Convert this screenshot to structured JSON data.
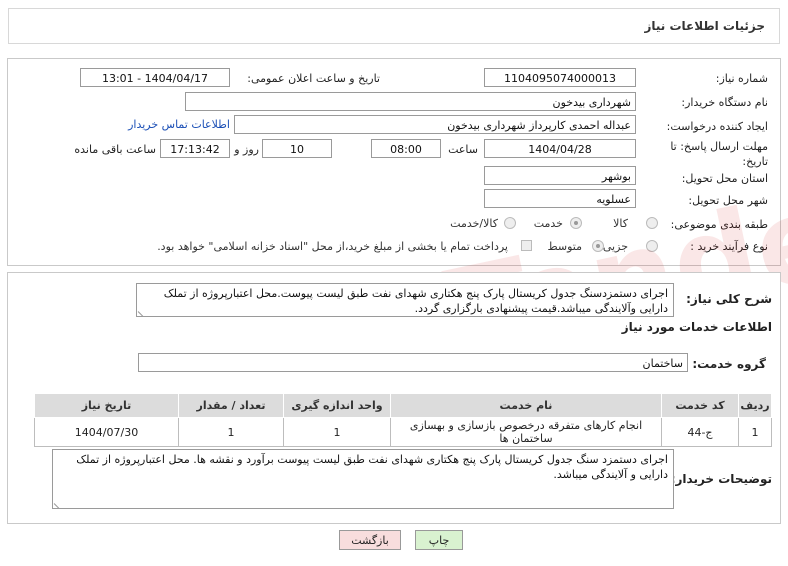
{
  "header": {
    "title": "جزئیات اطلاعات نیاز"
  },
  "fields": {
    "need_number_label": "شماره نیاز:",
    "need_number": "1104095074000013",
    "announce_label": "تاریخ و ساعت اعلان عمومی:",
    "announce_value": "1404/04/17 - 13:01",
    "buyer_org_label": "نام دستگاه خریدار:",
    "buyer_org": "شهرداری بیدخون",
    "creator_label": "ایجاد کننده درخواست:",
    "creator": "عبداله احمدی کارپرداز شهرداری بیدخون",
    "contact_link": "اطلاعات تماس خریدار",
    "deadline_label": "مهلت ارسال پاسخ: تا تاریخ:",
    "deadline_date": "1404/04/28",
    "time_label": "ساعت",
    "deadline_time": "08:00",
    "days_value": "10",
    "days_label": "روز و",
    "remaining_time": "17:13:42",
    "remaining_label": "ساعت باقی مانده",
    "province_label": "استان محل تحویل:",
    "province": "بوشهر",
    "city_label": "شهر محل تحویل:",
    "city": "عسلویه",
    "category_label": "طبقه بندی موضوعی:",
    "category_options": [
      "کالا",
      "خدمت",
      "کالا/خدمت"
    ],
    "process_label": "نوع فرآیند خرید :",
    "process_options": [
      "جزیی",
      "متوسط"
    ],
    "payment_note": "پرداخت تمام یا بخشی از مبلغ خرید،از محل \"اسناد خزانه اسلامی\" خواهد بود."
  },
  "description": {
    "label": "شرح کلی نیاز:",
    "text": "اجرای دستمزدسنگ جدول کریستال پارک پنج هکتاری شهدای نفت طبق لیست پیوست.محل اعتبارپروژه از تملک دارایی وآلایندگی میباشد.قیمت پیشنهادی بارگزاری گردد."
  },
  "services": {
    "section_title": "اطلاعات خدمات مورد نیاز",
    "group_label": "گروه خدمت:",
    "group_value": "ساختمان",
    "columns": [
      "ردیف",
      "کد خدمت",
      "نام خدمت",
      "واحد اندازه گیری",
      "تعداد / مقدار",
      "تاریخ نیاز"
    ],
    "rows": [
      [
        "1",
        "ج-44",
        "انجام کارهای متفرقه درخصوص بازسازی و بهسازی ساختمان ها",
        "1",
        "1",
        "1404/07/30"
      ]
    ]
  },
  "buyer_notes": {
    "label": "توضیحات خریدار:",
    "text": "اجرای دستمزد سنگ جدول کریستال پارک پنج هکتاری شهدای نفت طبق لیست پیوست برآورد  و نقشه ها. محل اعتبارپروژه از تملک دارایی و آلایندگی میباشد."
  },
  "buttons": {
    "print": "چاپ",
    "back": "بازگشت"
  },
  "watermark": "AriaTender.neT"
}
